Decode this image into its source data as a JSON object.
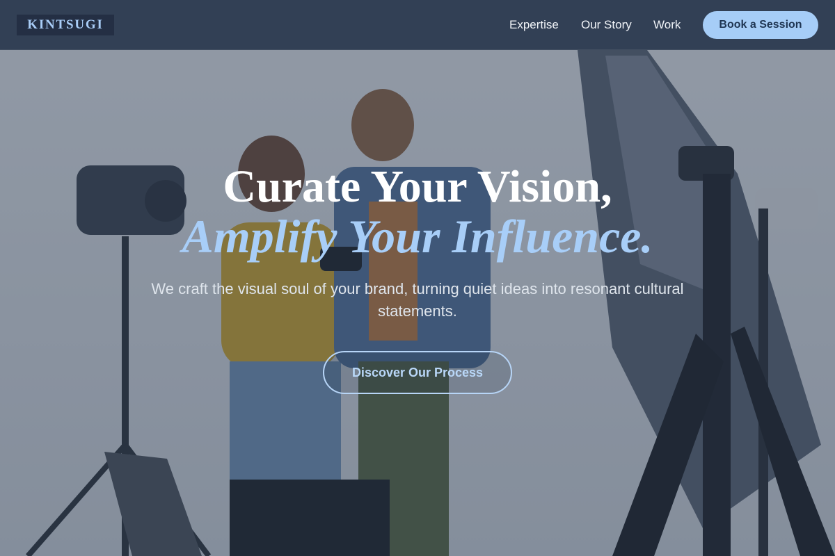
{
  "brand": {
    "logo_text": "KINTSUGI"
  },
  "nav": {
    "items": [
      {
        "label": "Expertise"
      },
      {
        "label": "Our Story"
      },
      {
        "label": "Work"
      }
    ],
    "cta_label": "Book a Session"
  },
  "hero": {
    "headline_line1": "Curate Your Vision,",
    "headline_line2": "Amplify Your Influence.",
    "subheadline": "We craft the visual soul of your brand, turning quiet ideas into resonant cultural statements.",
    "button_label": "Discover Our Process"
  },
  "colors": {
    "accent": "#a8cef8",
    "header_bg": "#2a384e",
    "heading": "#ffffff"
  }
}
